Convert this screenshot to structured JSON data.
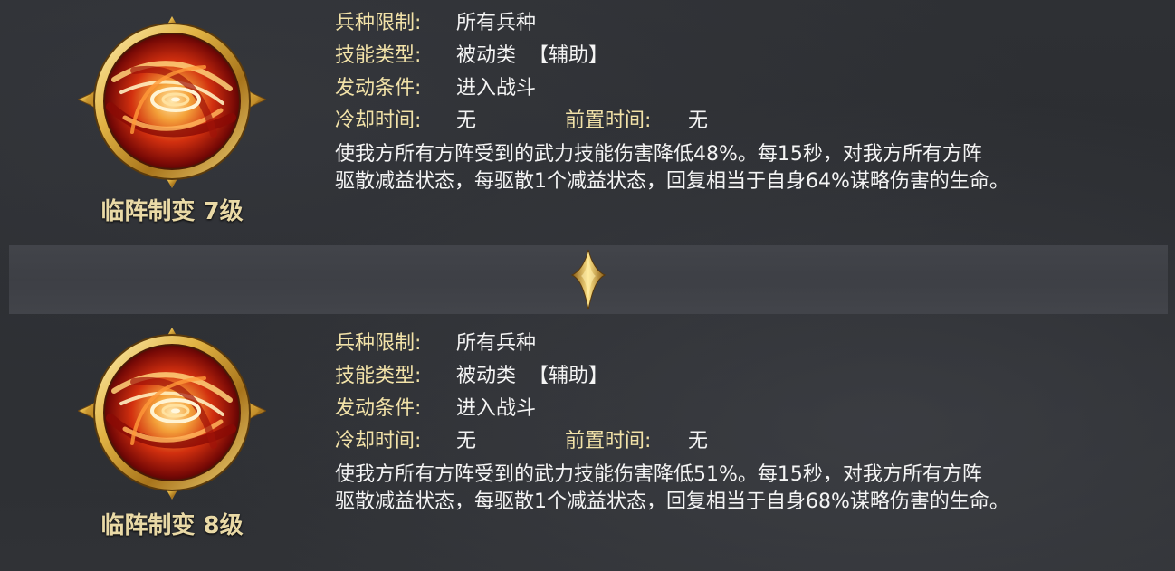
{
  "colors": {
    "label": "#f2e2a8",
    "value": "#f4f4f4",
    "name": "#e9d9a6",
    "gold": "#d4a93d",
    "swirl_red": "#c0180c",
    "swirl_orange": "#f07a1a"
  },
  "icons": {
    "skill_emblem": "fire-swirl-emblem-icon",
    "upgrade_arrow": "golden-arrow-down-icon"
  },
  "levels": [
    {
      "skill_name": "临阵制变 7级",
      "troop_label": "兵种限制:",
      "troop_value": "所有兵种",
      "type_label": "技能类型:",
      "type_value": "被动类",
      "type_tag": "【辅助】",
      "trigger_label": "发动条件:",
      "trigger_value": "进入战斗",
      "cooldown_label": "冷却时间:",
      "cooldown_value": "无",
      "precast_label": "前置时间:",
      "precast_value": "无",
      "description_line1": "使我方所有方阵受到的武力技能伤害降低48%。每15秒，对我方所有方阵",
      "description_line2": "驱散减益状态，每驱散1个减益状态，回复相当于自身64%谋略伤害的生命。"
    },
    {
      "skill_name": "临阵制变 8级",
      "troop_label": "兵种限制:",
      "troop_value": "所有兵种",
      "type_label": "技能类型:",
      "type_value": "被动类",
      "type_tag": "【辅助】",
      "trigger_label": "发动条件:",
      "trigger_value": "进入战斗",
      "cooldown_label": "冷却时间:",
      "cooldown_value": "无",
      "precast_label": "前置时间:",
      "precast_value": "无",
      "description_line1": "使我方所有方阵受到的武力技能伤害降低51%。每15秒，对我方所有方阵",
      "description_line2": "驱散减益状态，每驱散1个减益状态，回复相当于自身68%谋略伤害的生命。"
    }
  ]
}
